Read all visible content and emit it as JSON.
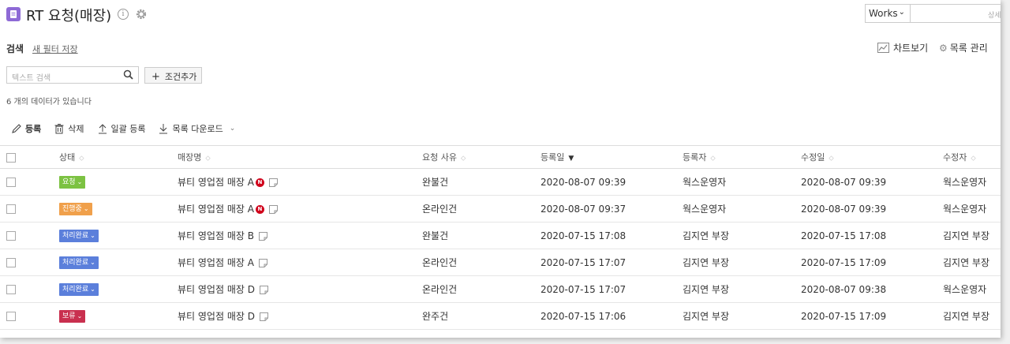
{
  "header": {
    "title": "RT 요청(매장)",
    "works_select": "Works",
    "top_search_placeholder": "상세"
  },
  "search": {
    "label": "검색",
    "new_filter": "새 필터 저장",
    "text_placeholder": "텍스트 검색",
    "add_condition": "조건추가",
    "chart_view": "차트보기",
    "list_manage": "목록 관리"
  },
  "count_text": "6 개의 데이터가 있습니다",
  "toolbar": {
    "register": "등록",
    "delete": "삭제",
    "bulk_register": "일괄 등록",
    "download": "목록 다운로드"
  },
  "columns": [
    "상태",
    "매장명",
    "요청 사유",
    "등록일",
    "등록자",
    "수정일",
    "수정자"
  ],
  "status_colors": {
    "요청": "#7cc242",
    "진행중": "#f0a04b",
    "처리완료": "#5b7fdb",
    "보류": "#c9304f"
  },
  "rows": [
    {
      "status": "요청",
      "store": "뷰티 영업점 매장 A",
      "new": "N",
      "reason": "완불건",
      "reg_date": "2020-08-07 09:39",
      "registrant": "웍스운영자",
      "mod_date": "2020-08-07 09:39",
      "modifier": "웍스운영자"
    },
    {
      "status": "진행중",
      "store": "뷰티 영업점 매장 A",
      "new": "N",
      "reason": "온라인건",
      "reg_date": "2020-08-07 09:37",
      "registrant": "웍스운영자",
      "mod_date": "2020-08-07 09:39",
      "modifier": "웍스운영자"
    },
    {
      "status": "처리완료",
      "store": "뷰티 영업점 매장 B",
      "reason": "완불건",
      "reg_date": "2020-07-15 17:08",
      "registrant": "김지연 부장",
      "mod_date": "2020-07-15 17:08",
      "modifier": "김지연 부장"
    },
    {
      "status": "처리완료",
      "store": "뷰티 영업점 매장 A",
      "reason": "온라인건",
      "reg_date": "2020-07-15 17:07",
      "registrant": "김지연 부장",
      "mod_date": "2020-07-15 17:09",
      "modifier": "김지연 부장"
    },
    {
      "status": "처리완료",
      "store": "뷰티 영업점 매장 D",
      "reason": "온라인건",
      "reg_date": "2020-07-15 17:07",
      "registrant": "김지연 부장",
      "mod_date": "2020-08-07 09:38",
      "modifier": "웍스운영자"
    },
    {
      "status": "보류",
      "store": "뷰티 영업점 매장 D",
      "reason": "완주건",
      "reg_date": "2020-07-15 17:06",
      "registrant": "김지연 부장",
      "mod_date": "2020-07-15 17:09",
      "modifier": "김지연 부장"
    }
  ]
}
